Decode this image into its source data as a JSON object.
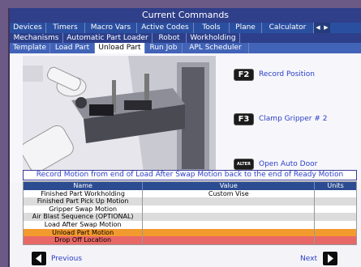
{
  "title": "Current Commands",
  "tabs_row1": [
    {
      "label": "Devices",
      "active": false
    },
    {
      "label": "Timers",
      "active": false
    },
    {
      "label": "Macro Vars",
      "active": false
    },
    {
      "label": "Active Codes",
      "active": false
    },
    {
      "label": "Tools",
      "active": false
    },
    {
      "label": "Plane",
      "active": false
    },
    {
      "label": "Calculator",
      "active": false
    }
  ],
  "tabs_row2": [
    {
      "label": "Mechanisms",
      "active": false
    },
    {
      "label": "Automatic Part Loader",
      "active": false
    },
    {
      "label": "Robot",
      "active": false
    },
    {
      "label": "Workholding",
      "active": false
    }
  ],
  "tabs_row3": [
    {
      "label": "Template",
      "active": false
    },
    {
      "label": "Load Part",
      "active": false
    },
    {
      "label": "Unload Part",
      "active": true
    },
    {
      "label": "Run Job",
      "active": false
    },
    {
      "label": "APL Scheduler",
      "active": false
    }
  ],
  "keys": {
    "f2": {
      "key": "F2",
      "label": "Record Position"
    },
    "f3": {
      "key": "F3",
      "label": "Clamp Gripper # 2"
    },
    "alter": {
      "key": "ALTER",
      "label": "Open Auto Door"
    }
  },
  "instruction": "Record Motion from end of Load After Swap Motion back to the end of Ready Motion",
  "table": {
    "headers": {
      "name": "Name",
      "value": "Value",
      "units": "Units"
    },
    "rows": [
      {
        "name": "Finished Part Workholding",
        "value": "Custom Vise",
        "units": "",
        "style": "odd"
      },
      {
        "name": "Finished Part Pick Up Motion",
        "value": "",
        "units": "",
        "style": "even"
      },
      {
        "name": "Gripper Swap Motion",
        "value": "",
        "units": "",
        "style": "odd"
      },
      {
        "name": "Air Blast Sequence (OPTIONAL)",
        "value": "",
        "units": "",
        "style": "even"
      },
      {
        "name": "Load After Swap Motion",
        "value": "",
        "units": "",
        "style": "odd"
      },
      {
        "name": "Unload Part Motion",
        "value": "",
        "units": "",
        "style": "orange"
      },
      {
        "name": "Drop Off Location",
        "value": "",
        "units": "",
        "style": "red"
      }
    ]
  },
  "nav": {
    "previous": "Previous",
    "next": "Next"
  },
  "colors": {
    "title_bar": "#2f3f8a",
    "tab_bar": "#2c4c92",
    "label_blue": "#2a3ec7",
    "highlight_orange": "#f39a2e",
    "highlight_red": "#e86767"
  }
}
